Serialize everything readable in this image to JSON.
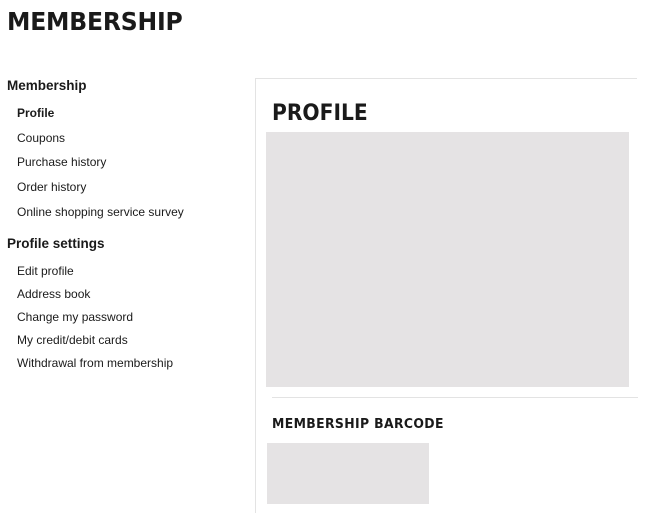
{
  "page": {
    "title": "MEMBERSHIP"
  },
  "sidebar": {
    "sections": [
      {
        "title": "Membership",
        "items": [
          {
            "label": "Profile",
            "active": true
          },
          {
            "label": "Coupons",
            "active": false
          },
          {
            "label": "Purchase history",
            "active": false
          },
          {
            "label": "Order history",
            "active": false
          },
          {
            "label": "Online shopping service survey",
            "active": false
          }
        ]
      },
      {
        "title": "Profile settings",
        "items": [
          {
            "label": "Edit profile",
            "active": false
          },
          {
            "label": "Address book",
            "active": false
          },
          {
            "label": "Change my password",
            "active": false
          },
          {
            "label": "My credit/debit cards",
            "active": false
          },
          {
            "label": "Withdrawal from membership",
            "active": false
          }
        ]
      }
    ]
  },
  "main": {
    "heading": "PROFILE",
    "barcode_heading": "MEMBERSHIP BARCODE"
  },
  "colors": {
    "text": "#1a1a1a",
    "placeholder_gray": "#e5e3e4",
    "divider": "#e3e3e3"
  }
}
